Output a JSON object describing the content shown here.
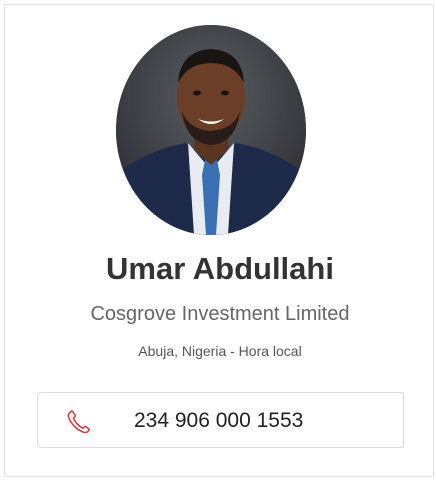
{
  "profile": {
    "name": "Umar Abdullahi",
    "company": "Cosgrove Investment Limited",
    "location": "Abuja, Nigeria - Hora local",
    "photo_icon": "profile-photo"
  },
  "contact": {
    "phone": "234 906 000 1553",
    "phone_icon": "phone-icon"
  },
  "colors": {
    "accent": "#d9373a",
    "border": "#e2e2e2",
    "text": "#333333"
  }
}
